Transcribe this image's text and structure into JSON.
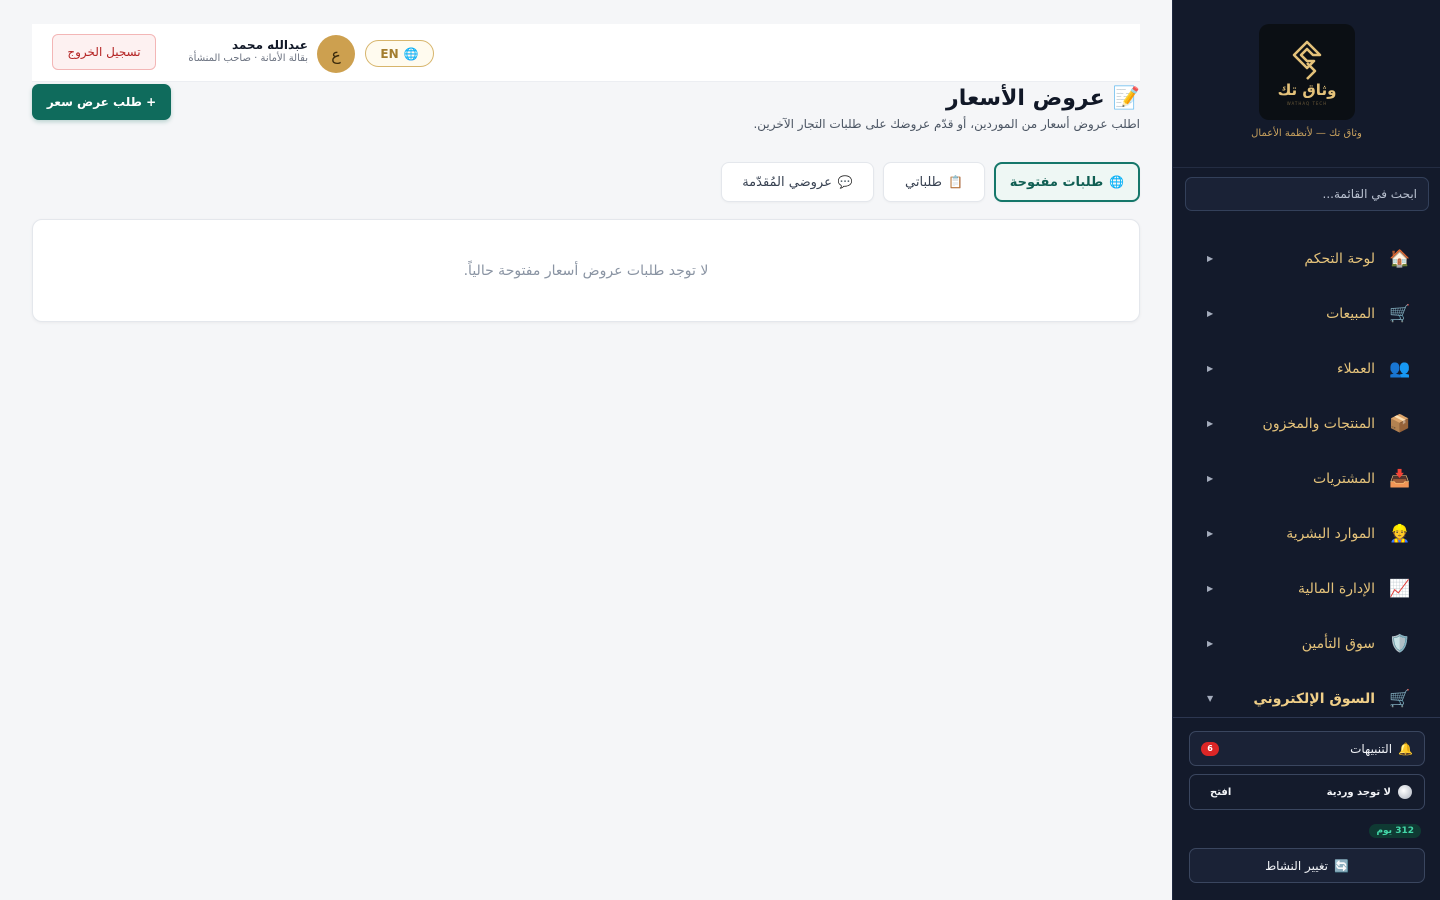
{
  "sidebar": {
    "brand_name": "وثاق تك",
    "brand_subtext": "WATHAQ TECH",
    "brand_tagline": "وثاق تك — لأنظمة الأعمال",
    "search_placeholder": "ابحث في القائمة...",
    "menu": [
      {
        "label": "لوحة التحكم",
        "icon": "🏠",
        "icon_name": "home-icon",
        "active": false
      },
      {
        "label": "المبيعات",
        "icon": "🛒",
        "icon_name": "cart-icon",
        "active": false
      },
      {
        "label": "العملاء",
        "icon": "👥",
        "icon_name": "users-icon",
        "active": false
      },
      {
        "label": "المنتجات والمخزون",
        "icon": "📦",
        "icon_name": "package-icon",
        "active": false
      },
      {
        "label": "المشتريات",
        "icon": "📥",
        "icon_name": "inbox-icon",
        "active": false
      },
      {
        "label": "الموارد البشرية",
        "icon": "👷",
        "icon_name": "worker-icon",
        "active": false
      },
      {
        "label": "الإدارة المالية",
        "icon": "📈",
        "icon_name": "chart-icon",
        "active": false
      },
      {
        "label": "سوق التأمين",
        "icon": "🛡️",
        "icon_name": "shield-icon",
        "active": false
      },
      {
        "label": "السوق الإلكتروني",
        "icon": "🛒",
        "icon_name": "cart-icon",
        "active": true
      }
    ],
    "notifications": {
      "label": "التنبيهات",
      "icon": "🔔",
      "count": "6"
    },
    "shift": {
      "status": "لا توجد وردية",
      "open_label": "افتح"
    },
    "days_badge": "312 يوم",
    "change_activity": {
      "label": "تغيير النشاط",
      "icon": "🔄"
    }
  },
  "topbar": {
    "logout_label": "تسجيل الخروج",
    "user_name": "عبدالله محمد",
    "user_role": "بقالة الأمانة · صاحب المنشأة",
    "avatar_letter": "ع",
    "lang_label": "EN",
    "lang_icon": "🌐"
  },
  "page": {
    "title": "عروض الأسعار",
    "title_icon": "📝",
    "subtitle": "اطلب عروض أسعار من الموردين، أو قدّم عروضك على طلبات التجار الآخرين.",
    "new_request_label": "+ طلب عرض سعر",
    "tabs": [
      {
        "label": "طلبات مفتوحة",
        "icon": "🌐",
        "active": true
      },
      {
        "label": "طلباتي",
        "icon": "📋",
        "active": false
      },
      {
        "label": "عروضي المُقدّمة",
        "icon": "💬",
        "active": false
      }
    ],
    "empty_message": "لا توجد طلبات عروض أسعار مفتوحة حالياً."
  },
  "colors": {
    "sidebar_bg": "#131a2b",
    "gold_accent": "#e4c27a",
    "primary_green": "#0f6b5c",
    "danger_red": "#b42323"
  }
}
